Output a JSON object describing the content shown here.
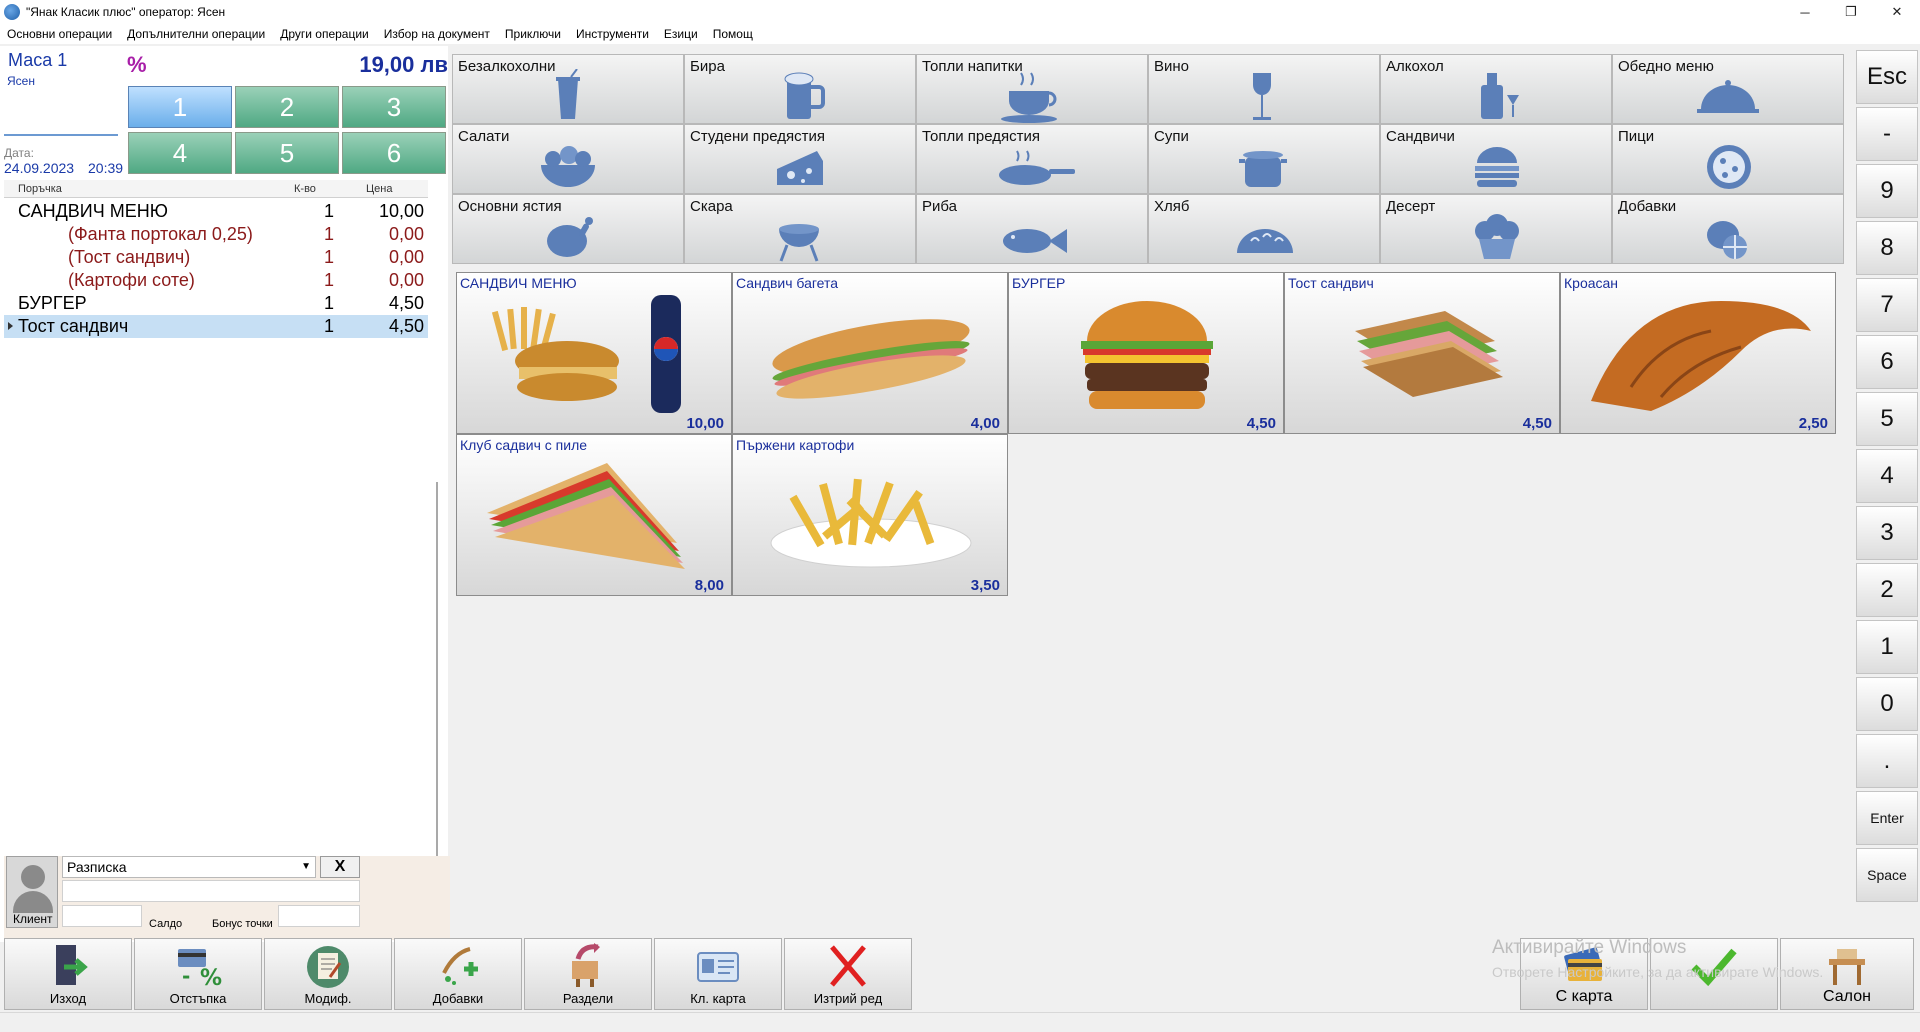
{
  "window": {
    "title": "\"Янак Класик плюс\" оператор: Ясен",
    "minimize": "─",
    "maximize": "❐",
    "close": "✕"
  },
  "menu": [
    "Основни операции",
    "Допълнителни операции",
    "Други операции",
    "Избор на документ",
    "Приключи",
    "Инструменти",
    "Езици",
    "Помощ"
  ],
  "order": {
    "table": "Маса 1",
    "operator": "Ясен",
    "percent_symbol": "%",
    "total": "19,00 лв",
    "date_label": "Дата:",
    "date": "24.09.2023",
    "time": "20:39",
    "keypad": [
      "1",
      "2",
      "3",
      "4",
      "5",
      "6"
    ],
    "headers": {
      "item": "Поръчка",
      "qty": "К-во",
      "price": "Цена"
    },
    "rows": [
      {
        "name": "САНДВИЧ МЕНЮ",
        "qty": "1",
        "price": "10,00",
        "sub": false
      },
      {
        "name": "(Фанта портокал 0,25)",
        "qty": "1",
        "price": "0,00",
        "sub": true
      },
      {
        "name": "(Тост сандвич)",
        "qty": "1",
        "price": "0,00",
        "sub": true
      },
      {
        "name": "(Картофи соте)",
        "qty": "1",
        "price": "0,00",
        "sub": true
      },
      {
        "name": "БУРГЕР",
        "qty": "1",
        "price": "4,50",
        "sub": false
      },
      {
        "name": "Тост сандвич",
        "qty": "1",
        "price": "4,50",
        "sub": false,
        "selected": true
      }
    ]
  },
  "client": {
    "label": "Клиент",
    "document_type": "Разписка",
    "clear": "X",
    "saldo_label": "Салдо",
    "bonus_label": "Бонус точки"
  },
  "categories": [
    {
      "label": "Безалкохолни",
      "icon": "soft-drink-icon"
    },
    {
      "label": "Бира",
      "icon": "beer-mug-icon"
    },
    {
      "label": "Топли напитки",
      "icon": "hot-cup-icon"
    },
    {
      "label": "Вино",
      "icon": "wine-glass-icon"
    },
    {
      "label": "Алкохол",
      "icon": "liquor-icon"
    },
    {
      "label": "Обедно меню",
      "icon": "cloche-icon"
    },
    {
      "label": "Салати",
      "icon": "salad-icon"
    },
    {
      "label": "Студени предястия",
      "icon": "cheese-icon"
    },
    {
      "label": "Топли предястия",
      "icon": "frying-pan-icon"
    },
    {
      "label": "Супи",
      "icon": "soup-pot-icon"
    },
    {
      "label": "Сандвичи",
      "icon": "burger-icon"
    },
    {
      "label": "Пици",
      "icon": "pizza-icon"
    },
    {
      "label": "Основни ястия",
      "icon": "roast-chicken-icon"
    },
    {
      "label": "Скара",
      "icon": "grill-icon"
    },
    {
      "label": "Риба",
      "icon": "fish-icon"
    },
    {
      "label": "Хляб",
      "icon": "bread-icon"
    },
    {
      "label": "Десерт",
      "icon": "cupcake-icon"
    },
    {
      "label": "Добавки",
      "icon": "lemon-icon"
    }
  ],
  "products": [
    {
      "label": "САНДВИЧ МЕНЮ",
      "price": "10,00",
      "image": "combo-menu-image"
    },
    {
      "label": "Сандвич багета",
      "price": "4,00",
      "image": "baguette-sandwich-image"
    },
    {
      "label": "БУРГЕР",
      "price": "4,50",
      "image": "burger-image"
    },
    {
      "label": "Тост сандвич",
      "price": "4,50",
      "image": "toast-sandwich-image"
    },
    {
      "label": "Кроасан",
      "price": "2,50",
      "image": "croissant-image"
    },
    {
      "label": "Клуб садвич с пиле",
      "price": "8,00",
      "image": "club-sandwich-image"
    },
    {
      "label": "Пържени картофи",
      "price": "3,50",
      "image": "french-fries-image"
    }
  ],
  "side_keys": [
    "Esc",
    "-",
    "9",
    "8",
    "7",
    "6",
    "5",
    "4",
    "3",
    "2",
    "1",
    "0",
    ".",
    "Enter",
    "Space"
  ],
  "toolbar": {
    "exit": "Изход",
    "discount": "Отстъпка",
    "modify": "Модиф.",
    "addons": "Добавки",
    "split": "Раздели",
    "client_card": "Кл. карта",
    "delete_row": "Изтрий ред",
    "card_payment": "С карта",
    "salon": "Салон"
  },
  "watermark": {
    "line1": "Активирайте Windows",
    "line2": "Отворете Настройките, за да активирате Windows."
  },
  "colors": {
    "accent_blue": "#1a2f9c",
    "keypad_green": "#4fa983",
    "keypad_selected": "#6aaeea",
    "icon_blue": "#5b7fb8",
    "sub_item_red": "#8b1a1a"
  }
}
